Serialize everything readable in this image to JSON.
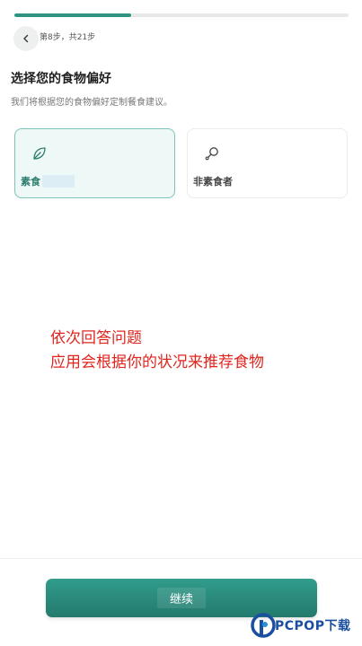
{
  "progress": {
    "fraction": 0.35,
    "step_text": "第8步，共21步"
  },
  "header": {
    "back_icon": "chevron-left-icon"
  },
  "question": {
    "title": "选择您的食物偏好",
    "subtitle": "我们将根据您的食物偏好定制餐食建议。"
  },
  "options": [
    {
      "label": "素食",
      "icon": "leaf-icon",
      "selected": true
    },
    {
      "label": "非素食者",
      "icon": "meat-drumstick-icon",
      "selected": false
    }
  ],
  "annotation": {
    "line1": "依次回答问题",
    "line2": "应用会根据你的状况来推荐食物"
  },
  "footer": {
    "continue_label": "继续"
  },
  "watermark": {
    "text": "PCPOP下载"
  },
  "colors": {
    "accent": "#2f9283",
    "selected_bg": "#eef8f6",
    "annotation": "#e0251f",
    "watermark": "#1a4fa0"
  }
}
